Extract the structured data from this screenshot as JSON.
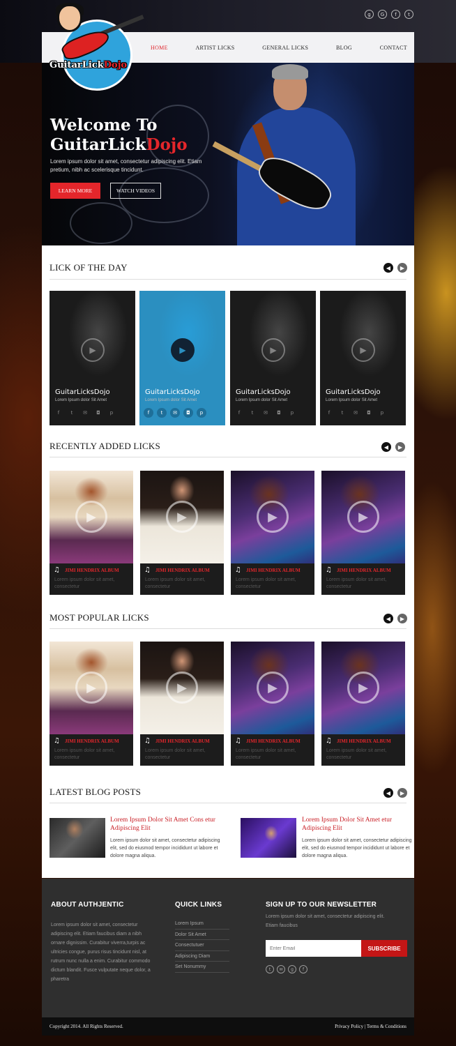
{
  "brand": {
    "name_part1": "GuitarLick",
    "name_part2": "Dojo"
  },
  "top_social": [
    "google-plus-icon",
    "google-icon",
    "facebook-icon",
    "twitter-icon"
  ],
  "nav": {
    "items": [
      "HOME",
      "ARTIST LICKS",
      "GENERAL LICKS",
      "BLOG",
      "CONTACT"
    ],
    "active": "HOME"
  },
  "hero": {
    "title_line1": "Welcome To",
    "title_line2a": "GuitarLick",
    "title_line2b": "Dojo",
    "text": "Lorem ipsum dolor sit amet, consectetur adipiscing elit. Etiam pretium, nibh ac scelerisque tincidunt.",
    "btn_primary": "LEARN MORE",
    "btn_secondary": "WATCH VIDEOS"
  },
  "sections": {
    "lick_of_day": "LICK OF THE DAY",
    "recent": "RECENTLY ADDED LICKS",
    "popular": "MOST POPULAR LICKS",
    "blog": "LATEST BLOG POSTS"
  },
  "licks": [
    {
      "title": "GuitarLicksDojo",
      "sub": "Lorem Ipsum dolor Sit Amet"
    },
    {
      "title": "GuitarLicksDojo",
      "sub": "Lorem Ipsum dolor Sit Amet"
    },
    {
      "title": "GuitarLicksDojo",
      "sub": "Lorem Ipsum dolor Sit Amet"
    },
    {
      "title": "GuitarLicksDojo",
      "sub": "Lorem Ipsum dolor Sit Amet"
    }
  ],
  "album": {
    "title": "JIMI HENDRIX ALBUM",
    "desc": "Lorem ipsum dolor sit amet, consectetur"
  },
  "posts": [
    {
      "title": "Lorem Ipsum Dolor Sit Amet Cons etur Adipiscing Elit",
      "text": "Lorem ipsum dolor sit amet, consectetur adipiscing elit, sed do eiusmod tempor incididunt ut labore et dolore magna aliqua."
    },
    {
      "title": "Lorem Ipsum Dolor Sit Amet etur Adipiscing Elit",
      "text": "Lorem ipsum dolor sit amet, consectetur adipiscing elit, sed do eiusmod tempor incididunt ut labore et dolore magna aliqua."
    }
  ],
  "footer": {
    "about_title": "ABOUT AUTHJENTIC",
    "about_text": "Lorem ipsum dolor sit amet, consectetur adipiscing elit. Etiam faucibus diam a nibh ornare dignissim. Curabitur viverra,turpis ac ultricies congue, purus risus tincidunt nisl, at rutrum nunc nulla a enim. Curabitur commodo dictum blandit. Fusce vulputate neque dolor, a pharetra",
    "links_title": "QUICK LINKS",
    "links": [
      "Lorem Ipsum",
      "Dolor Sit Amet",
      "Consectutuer",
      "Adipiscing Diam",
      "Set Nonummy"
    ],
    "newsletter_title": "SIGN UP TO OUR NEWSLETTER",
    "newsletter_text": "Lorem ipsum dolor sit amet, consectetur adipiscing elit. Etiam faucibus",
    "email_placeholder": "Enter Email",
    "subscribe": "SUBSCRIBE"
  },
  "bottom": {
    "copyright": "Copyright 2014. All Rights Reserved.",
    "links": "Privacy Policy  |  Terms & Conditions"
  },
  "colors": {
    "accent": "#e4262b",
    "lick_highlight": "#2b8fc0",
    "footer": "#2f2f2f"
  }
}
